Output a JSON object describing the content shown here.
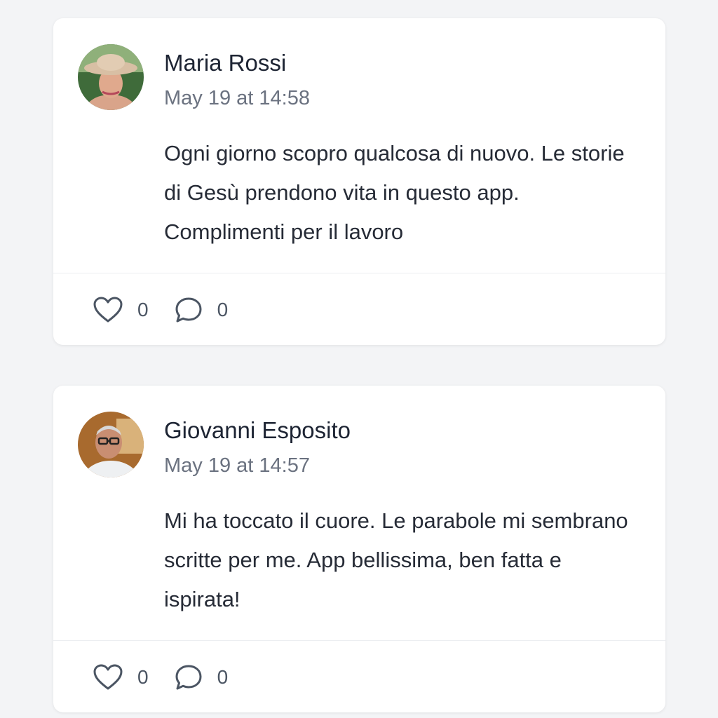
{
  "posts": [
    {
      "author": "Maria Rossi",
      "timestamp": "May 19 at 14:58",
      "text": "Ogni giorno scopro qualcosa di nuovo. Le storie di Gesù prendono vita in questo app. Complimenti per il lavoro",
      "likes": "0",
      "comments": "0",
      "avatar": "woman-with-hat-photo"
    },
    {
      "author": "Giovanni Esposito",
      "timestamp": "May 19 at 14:57",
      "text": "Mi ha toccato il cuore. Le parabole mi sembrano scritte per me. App bellissima, ben fatta e ispirata!",
      "likes": "0",
      "comments": "0",
      "avatar": "man-with-glasses-photo"
    }
  ],
  "icons": {
    "like": "heart-icon",
    "comment": "speech-bubble-icon"
  },
  "colors": {
    "background": "#f3f4f6",
    "card": "#ffffff",
    "text": "#262b36",
    "muted": "#6b7280",
    "icon": "#4b5563"
  }
}
